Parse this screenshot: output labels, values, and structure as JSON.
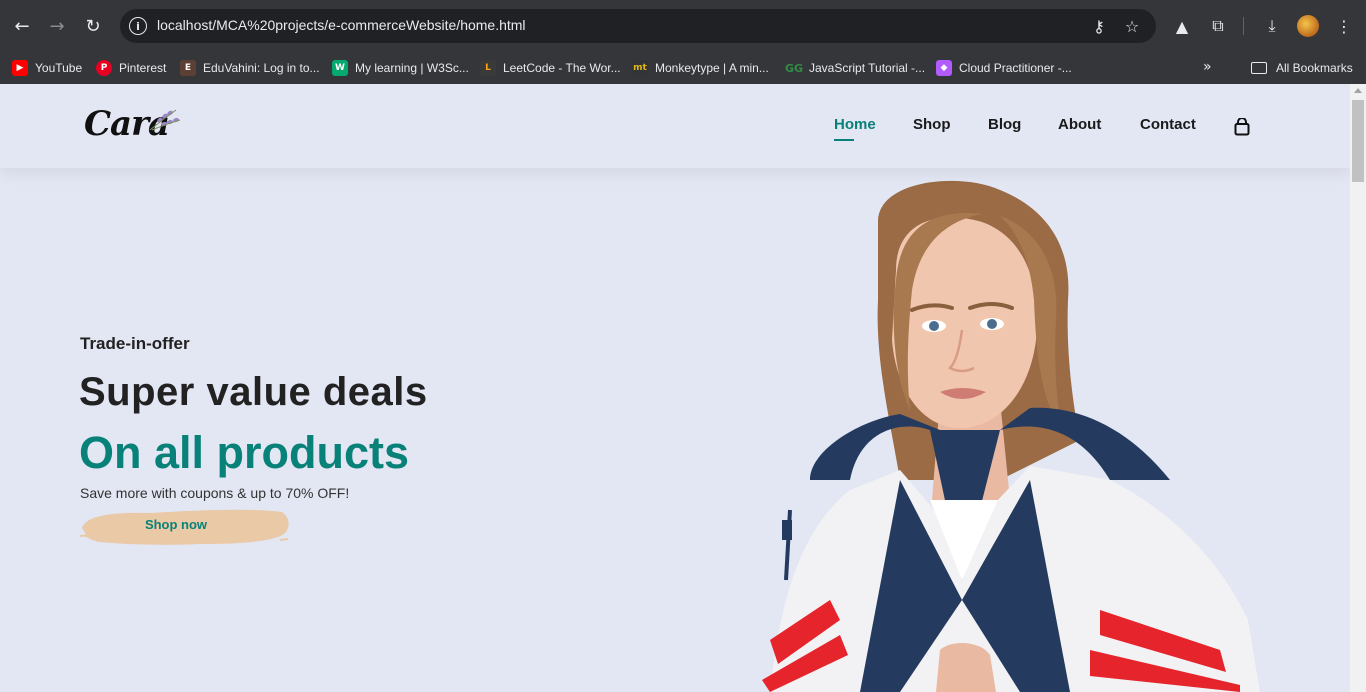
{
  "browser": {
    "url": "localhost/MCA%20projects/e-commerceWebsite/home.html",
    "bookmarks": [
      {
        "label": "YouTube",
        "icon": "youtube-icon",
        "color": "#ff0000"
      },
      {
        "label": "Pinterest",
        "icon": "pinterest-icon",
        "color": "#e60023"
      },
      {
        "label": "EduVahini: Log in to...",
        "icon": "eduvahini-icon",
        "color": "#5c4033"
      },
      {
        "label": "My learning | W3Sc...",
        "icon": "w3schools-icon",
        "color": "#04aa6d"
      },
      {
        "label": "LeetCode - The Wor...",
        "icon": "leetcode-icon",
        "color": "#ffa116"
      },
      {
        "label": "Monkeytype | A min...",
        "icon": "monkeytype-icon",
        "color": "#e2b714"
      },
      {
        "label": "JavaScript Tutorial -...",
        "icon": "geeksforgeeks-icon",
        "color": "#2f8d46"
      },
      {
        "label": "Cloud Practitioner -...",
        "icon": "cube-icon",
        "color": "#b05cff"
      }
    ],
    "all_bookmarks": "All Bookmarks"
  },
  "site": {
    "logo": "Cara",
    "nav": [
      {
        "label": "Home",
        "active": true
      },
      {
        "label": "Shop",
        "active": false
      },
      {
        "label": "Blog",
        "active": false
      },
      {
        "label": "About",
        "active": false
      },
      {
        "label": "Contact",
        "active": false
      }
    ],
    "cart_icon": "shopping-bag-icon"
  },
  "hero": {
    "eyebrow": "Trade-in-offer",
    "heading": "Super value deals",
    "highlight": "On all products",
    "subtext": "Save more with coupons & up to 70% OFF!",
    "button": "Shop now"
  },
  "colors": {
    "accent": "#088178",
    "page_bg": "#e3e6f3",
    "button_brush": "#e9c9a6"
  }
}
